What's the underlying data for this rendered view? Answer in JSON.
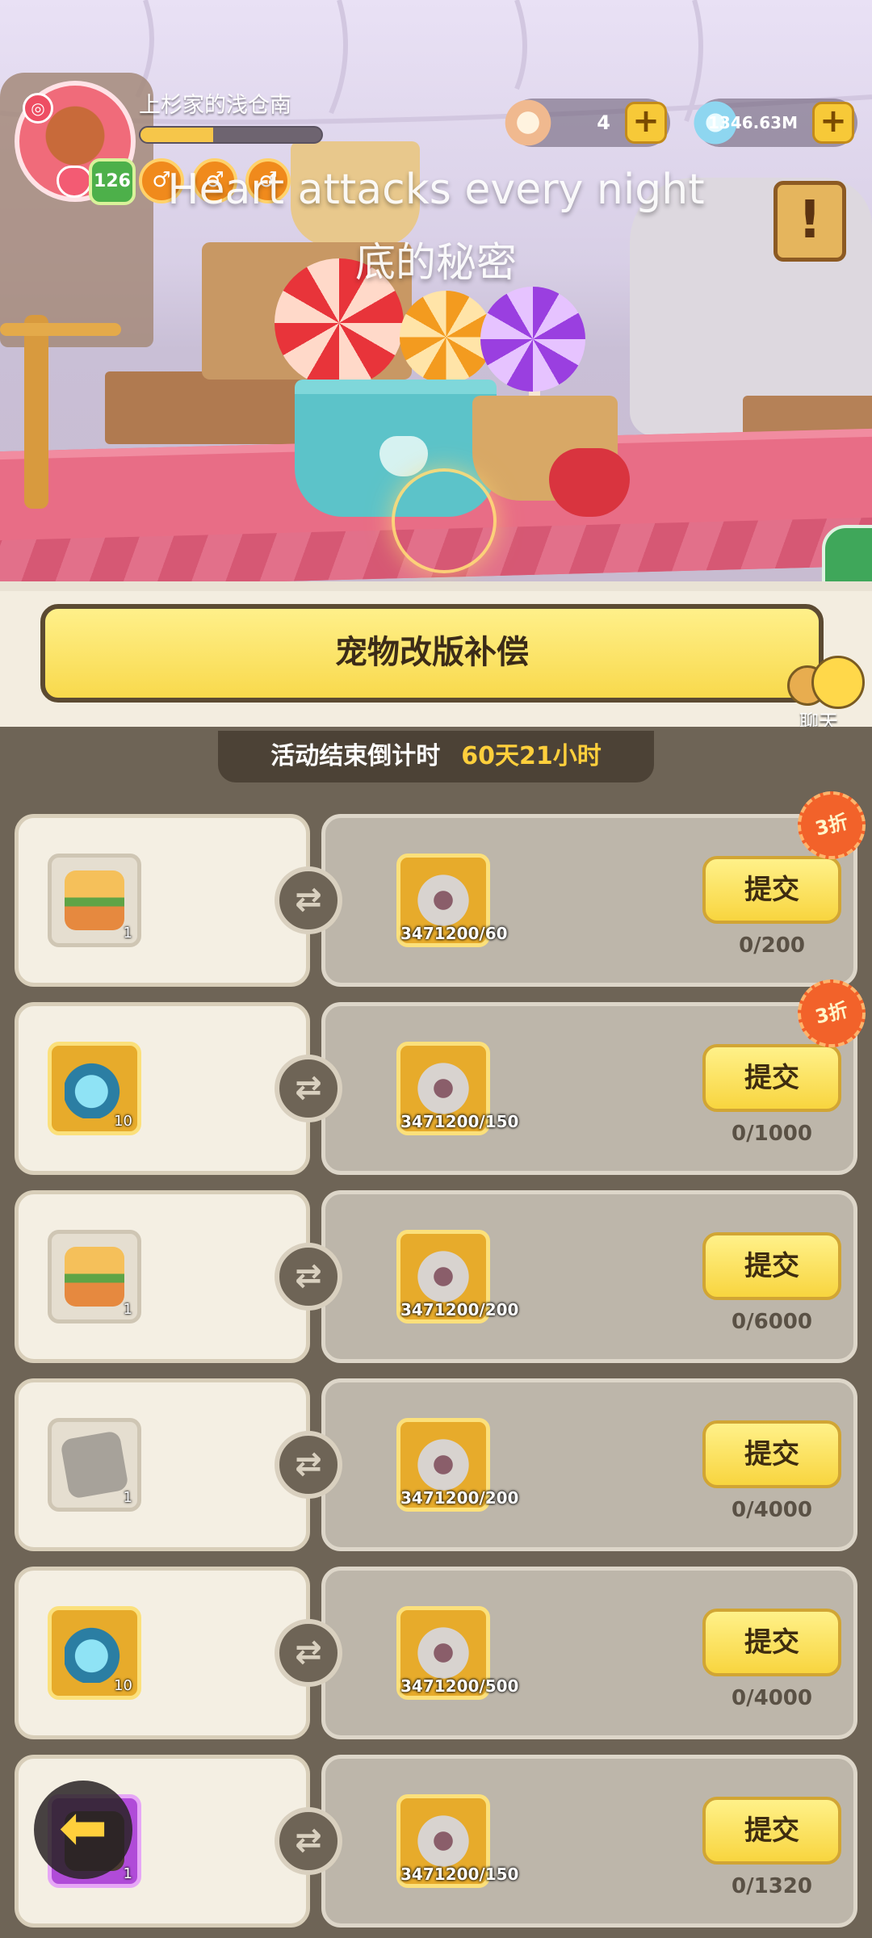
{
  "header": {
    "player_name": "上杉家的浅仓南",
    "level": "126",
    "xp_fraction": 0.4,
    "buffs": [
      "♂",
      "♂",
      "♂"
    ],
    "currency": [
      {
        "name": "pearl",
        "value": "4"
      },
      {
        "name": "diamond",
        "value": "1346.63M"
      }
    ],
    "plus_label": "+",
    "notice_icon": "!"
  },
  "subtitles": {
    "line1": "Heart attacks every night",
    "line2": "底的秘密"
  },
  "event": {
    "title": "宠物改版补偿",
    "chat_label": "聊天",
    "countdown_label": "活动结束倒计时",
    "countdown_value": "60天21小时"
  },
  "rows": [
    {
      "reward_icon": "roast-food-icon",
      "reward_count": "1",
      "requirement": "3471200/60",
      "submit": "提交",
      "progress": "0/200",
      "discount": "3折"
    },
    {
      "reward_icon": "potion-icon",
      "reward_count": "10",
      "requirement": "3471200/150",
      "submit": "提交",
      "progress": "0/1000",
      "discount": "3折"
    },
    {
      "reward_icon": "roast-food-icon",
      "reward_count": "1",
      "requirement": "3471200/200",
      "submit": "提交",
      "progress": "0/6000",
      "discount": ""
    },
    {
      "reward_icon": "stone-tablet-icon",
      "reward_count": "1",
      "requirement": "3471200/200",
      "submit": "提交",
      "progress": "0/4000",
      "discount": ""
    },
    {
      "reward_icon": "potion-icon",
      "reward_count": "10",
      "requirement": "3471200/500",
      "submit": "提交",
      "progress": "0/4000",
      "discount": ""
    },
    {
      "reward_icon": "locked-item-icon",
      "reward_count": "1",
      "requirement": "3471200/150",
      "submit": "提交",
      "progress": "0/1320",
      "discount": ""
    }
  ],
  "back_icon": "back-arrow-icon"
}
